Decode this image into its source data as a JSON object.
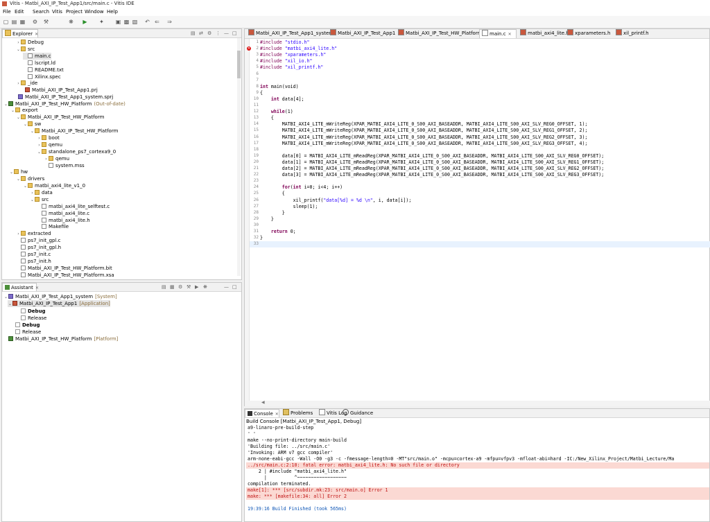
{
  "window": {
    "title": "Vitis - Matbi_AXI_IP_Test_App1/src/main.c - Vitis IDE"
  },
  "menu": [
    "File",
    "Edit",
    "Search",
    "Vitis",
    "Project",
    "Window",
    "Help"
  ],
  "explorer": {
    "tab": "Explorer",
    "items": [
      {
        "t": "Debug",
        "i": "folder"
      },
      {
        "t": "src",
        "i": "folder"
      },
      {
        "t": "main.c",
        "i": "file"
      },
      {
        "t": "lscript.ld",
        "i": "file"
      },
      {
        "t": "README.txt",
        "i": "file"
      },
      {
        "t": "Xilinx.spec",
        "i": "file"
      },
      {
        "t": "_ide",
        "i": "folder"
      },
      {
        "t": "Matbi_AXI_IP_Test_App1.prj",
        "i": "proj"
      },
      {
        "t": "Matbi_AXI_IP_Test_App1_system.sprj",
        "i": "sys"
      },
      {
        "t": "Matbi_AXI_IP_Test_HW_Platform",
        "i": "plat",
        "suffix": "(Out-of-date)"
      },
      {
        "t": "export",
        "i": "folder"
      },
      {
        "t": "Matbi_AXI_IP_Test_HW_Platform",
        "i": "folder"
      },
      {
        "t": "sw",
        "i": "folder"
      },
      {
        "t": "Matbi_AXI_IP_Test_HW_Platform",
        "i": "folder"
      },
      {
        "t": "boot",
        "i": "folder"
      },
      {
        "t": "qemu",
        "i": "folder"
      },
      {
        "t": "standalone_ps7_cortexa9_0",
        "i": "folder"
      },
      {
        "t": "qemu",
        "i": "folder"
      },
      {
        "t": "system.mss",
        "i": "file"
      },
      {
        "t": "hw",
        "i": "folder"
      },
      {
        "t": "drivers",
        "i": "folder"
      },
      {
        "t": "matbi_axi4_lite_v1_0",
        "i": "folder"
      },
      {
        "t": "data",
        "i": "folder"
      },
      {
        "t": "src",
        "i": "folder"
      },
      {
        "t": "matbi_axi4_lite_selftest.c",
        "i": "file"
      },
      {
        "t": "matbi_axi4_lite.c",
        "i": "file"
      },
      {
        "t": "matbi_axi4_lite.h",
        "i": "file"
      },
      {
        "t": "Makefile",
        "i": "file"
      },
      {
        "t": "extracted",
        "i": "folder"
      },
      {
        "t": "ps7_init_gpl.c",
        "i": "file"
      },
      {
        "t": "ps7_init_gpl.h",
        "i": "file"
      },
      {
        "t": "ps7_init.c",
        "i": "file"
      },
      {
        "t": "ps7_init.h",
        "i": "file"
      },
      {
        "t": "Matbi_AXI_IP_Test_HW_Platform.bit",
        "i": "file"
      },
      {
        "t": "Matbi_AXI_IP_Test_HW_Platform.xsa",
        "i": "file"
      }
    ]
  },
  "assistant": {
    "tab": "Assistant",
    "items": [
      {
        "t": "Matbi_AXI_IP_Test_App1_system",
        "i": "sys",
        "suffix": "[System]"
      },
      {
        "t": "Matbi_AXI_IP_Test_App1",
        "i": "proj",
        "suffix": "[Application]"
      },
      {
        "t": "Debug",
        "i": "ham"
      },
      {
        "t": "Release",
        "i": "ham"
      },
      {
        "t": "Debug",
        "i": "ham"
      },
      {
        "t": "Release",
        "i": "ham"
      },
      {
        "t": "Matbi_AXI_IP_Test_HW_Platform",
        "i": "plat",
        "suffix": "[Platform]"
      }
    ]
  },
  "editor": {
    "tabs": [
      "Matbi_AXI_IP_Test_App1_system",
      "Matbi_AXI_IP_Test_App1",
      "Matbi_AXI_IP_Test_HW_Platform",
      "main.c",
      "matbi_axi4_lite.h",
      "xparameters.h",
      "xil_printf.h"
    ],
    "lines": [
      "#include \"stdio.h\"",
      "#include \"matbi_axi4_lite.h\"",
      "#include \"xparameters.h\"",
      "#include \"xil_io.h\"",
      "#include \"xil_printf.h\"",
      "",
      "",
      "int main(void)",
      "{",
      "    int data[4];",
      "",
      "    while(1)",
      "    {",
      "        MATBI_AXI4_LITE_mWriteReg(XPAR_MATBI_AXI4_LITE_0_S00_AXI_BASEADDR, MATBI_AXI4_LITE_S00_AXI_SLV_REG0_OFFSET, 1);",
      "        MATBI_AXI4_LITE_mWriteReg(XPAR_MATBI_AXI4_LITE_0_S00_AXI_BASEADDR, MATBI_AXI4_LITE_S00_AXI_SLV_REG1_OFFSET, 2);",
      "        MATBI_AXI4_LITE_mWriteReg(XPAR_MATBI_AXI4_LITE_0_S00_AXI_BASEADDR, MATBI_AXI4_LITE_S00_AXI_SLV_REG2_OFFSET, 3);",
      "        MATBI_AXI4_LITE_mWriteReg(XPAR_MATBI_AXI4_LITE_0_S00_AXI_BASEADDR, MATBI_AXI4_LITE_S00_AXI_SLV_REG3_OFFSET, 4);",
      "",
      "        data[0] = MATBI_AXI4_LITE_mReadReg(XPAR_MATBI_AXI4_LITE_0_S00_AXI_BASEADDR, MATBI_AXI4_LITE_S00_AXI_SLV_REG0_OFFSET);",
      "        data[1] = MATBI_AXI4_LITE_mReadReg(XPAR_MATBI_AXI4_LITE_0_S00_AXI_BASEADDR, MATBI_AXI4_LITE_S00_AXI_SLV_REG1_OFFSET);",
      "        data[2] = MATBI_AXI4_LITE_mReadReg(XPAR_MATBI_AXI4_LITE_0_S00_AXI_BASEADDR, MATBI_AXI4_LITE_S00_AXI_SLV_REG2_OFFSET);",
      "        data[3] = MATBI_AXI4_LITE_mReadReg(XPAR_MATBI_AXI4_LITE_0_S00_AXI_BASEADDR, MATBI_AXI4_LITE_S00_AXI_SLV_REG3_OFFSET);",
      "",
      "        for(int i=0; i<4; i++)",
      "        {",
      "            xil_printf(\"data[%d] = %d \\n\", i, data[i]);",
      "            sleep(1);",
      "        }",
      "    }",
      "",
      "    return 0;",
      "}",
      ""
    ]
  },
  "console": {
    "tabs": [
      "Console",
      "Problems",
      "Vitis Log",
      "Guidance"
    ],
    "header": "Build Console [Matbi_AXI_IP_Test_App1, Debug]",
    "lines": [
      {
        "t": "a9-linaro-pre-build-step",
        "k": ""
      },
      {
        "t": "' '",
        "k": ""
      },
      {
        "t": "make --no-print-directory main-build",
        "k": ""
      },
      {
        "t": "'Building file: ../src/main.c'",
        "k": ""
      },
      {
        "t": "'Invoking: ARM v7 gcc compiler'",
        "k": ""
      },
      {
        "t": "arm-none-eabi-gcc -Wall -O0 -g3 -c -fmessage-length=0 -MT\"src/main.o\" -mcpu=cortex-a9 -mfpu=vfpv3 -mfloat-abi=hard -IC:/New_Xilinx_Project/Matbi_Lecture/Ma",
        "k": ""
      },
      {
        "t": "../src/main.c:2:10: fatal error: matbi_axi4_lite.h: No such file or directory",
        "k": "err"
      },
      {
        "t": "    2 | #include \"matbi_axi4_lite.h\"",
        "k": ""
      },
      {
        "t": "      |          ^~~~~~~~~~~~~~~~~~~",
        "k": ""
      },
      {
        "t": "compilation terminated.",
        "k": ""
      },
      {
        "t": "make[1]: *** [src/subdir.mk:23: src/main.o] Error 1",
        "k": "err"
      },
      {
        "t": "make: *** [makefile:34: all] Error 2",
        "k": "err"
      },
      {
        "t": "",
        "k": ""
      },
      {
        "t": "19:39:16 Build Finished (took 565ms)",
        "k": "info"
      }
    ]
  }
}
